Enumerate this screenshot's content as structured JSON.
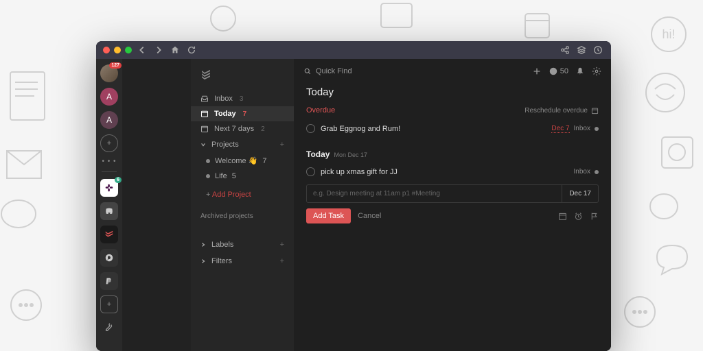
{
  "rail": {
    "badge": "127",
    "letterA": "A",
    "slackBadge": "6"
  },
  "sidebar": {
    "inbox": {
      "label": "Inbox",
      "count": "3"
    },
    "today": {
      "label": "Today",
      "count": "7"
    },
    "next7": {
      "label": "Next 7 days",
      "count": "2"
    },
    "projectsLabel": "Projects",
    "projects": [
      {
        "name": "Welcome 👋",
        "count": "7"
      },
      {
        "name": "Life",
        "count": "5"
      }
    ],
    "addProject": "Add Project",
    "archived": "Archived projects",
    "labels": "Labels",
    "filters": "Filters"
  },
  "topbar": {
    "searchPlaceholder": "Quick Find",
    "karma": "50"
  },
  "content": {
    "title": "Today",
    "overdueLabel": "Overdue",
    "reschedule": "Reschedule overdue",
    "overdueTasks": [
      {
        "title": "Grab Eggnog and Rum!",
        "date": "Dec 7",
        "project": "Inbox"
      }
    ],
    "todayHeader": {
      "label": "Today",
      "date": "Mon Dec 17"
    },
    "todayTasks": [
      {
        "title": "pick up xmas gift for JJ",
        "project": "Inbox"
      }
    ],
    "addInput": {
      "placeholder": "e.g. Design meeting at 11am p1 #Meeting",
      "date": "Dec 17"
    },
    "addButton": "Add Task",
    "cancel": "Cancel"
  }
}
